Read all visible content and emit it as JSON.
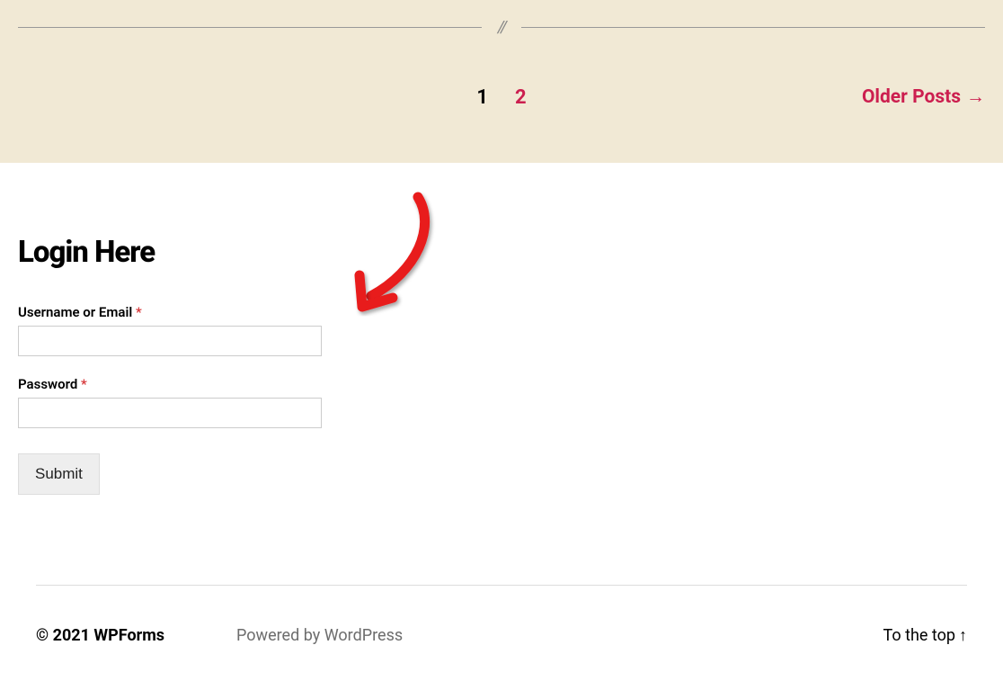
{
  "pagination": {
    "current": "1",
    "next": "2",
    "older_posts": "Older Posts"
  },
  "login": {
    "heading": "Login Here",
    "username_label": "Username or Email",
    "password_label": "Password",
    "required_mark": "*",
    "submit_label": "Submit"
  },
  "footer": {
    "copyright": "© 2021 WPForms",
    "powered": "Powered by WordPress",
    "to_top": "To the top"
  }
}
